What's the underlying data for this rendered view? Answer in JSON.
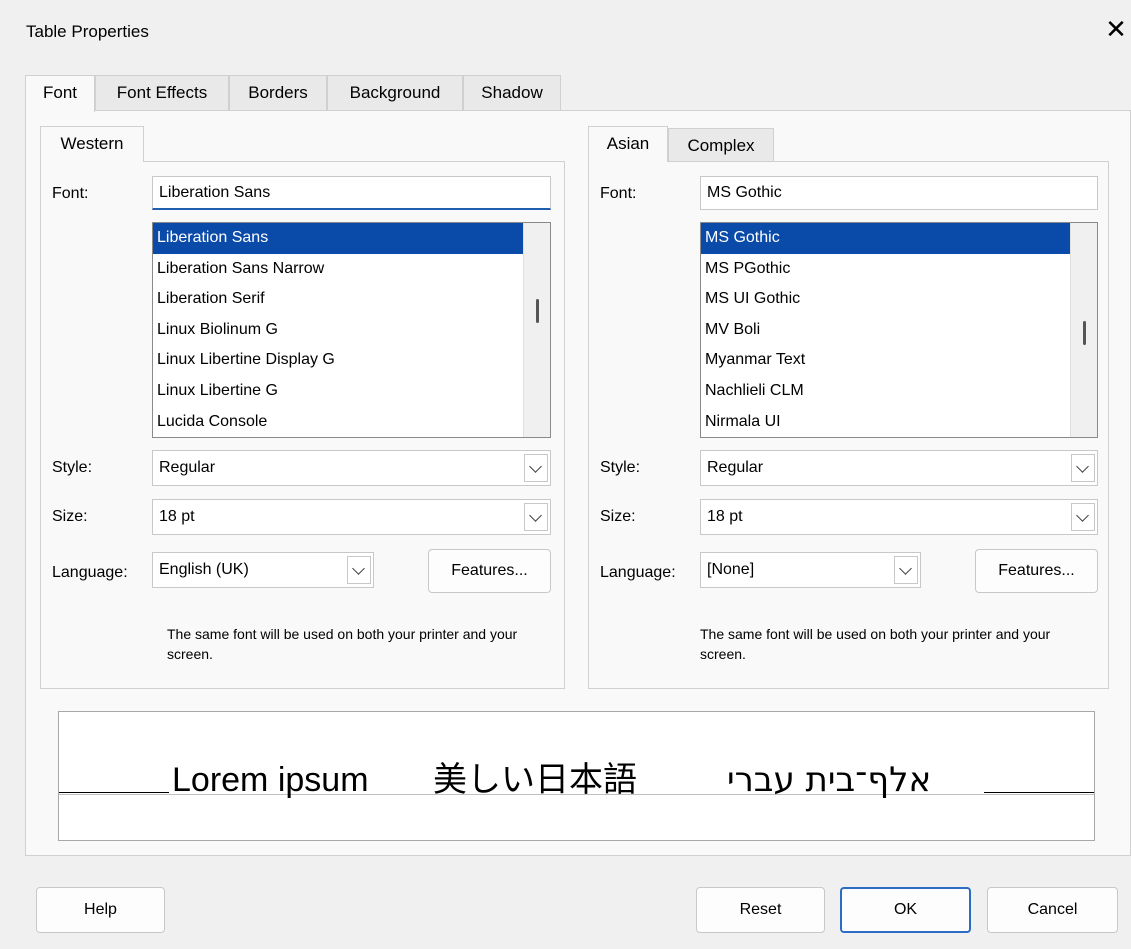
{
  "window": {
    "title": "Table Properties",
    "close_glyph": "✕"
  },
  "tabs": [
    "Font",
    "Font Effects",
    "Borders",
    "Background",
    "Shadow"
  ],
  "western": {
    "tab": "Western",
    "font_label": "Font:",
    "font_value": "Liberation Sans",
    "font_list": [
      "Liberation Sans",
      "Liberation Sans Narrow",
      "Liberation Serif",
      "Linux Biolinum G",
      "Linux Libertine Display G",
      "Linux Libertine G",
      "Lucida Console"
    ],
    "style_label": "Style:",
    "style_value": "Regular",
    "size_label": "Size:",
    "size_value": "18 pt",
    "language_label": "Language:",
    "language_value": "English (UK)",
    "features_label": "Features...",
    "note": "The same font will be used on both your printer and your screen."
  },
  "asian": {
    "tabs": [
      "Asian",
      "Complex"
    ],
    "font_label": "Font:",
    "font_value": "MS Gothic",
    "font_list": [
      "MS Gothic",
      "MS PGothic",
      "MS UI Gothic",
      "MV Boli",
      "Myanmar Text",
      "Nachlieli CLM",
      "Nirmala UI"
    ],
    "style_label": "Style:",
    "style_value": "Regular",
    "size_label": "Size:",
    "size_value": "18 pt",
    "language_label": "Language:",
    "language_value": "[None]",
    "features_label": "Features...",
    "note": "The same font will be used on both your printer and your screen."
  },
  "preview": {
    "latin": "Lorem ipsum",
    "japanese": "美しい日本語",
    "hebrew": "אלף־בית עברי"
  },
  "buttons": {
    "help": "Help",
    "reset": "Reset",
    "ok": "OK",
    "cancel": "Cancel"
  },
  "colors": {
    "selection": "#0a4aa8",
    "default_button_border": "#2b6cc4",
    "dialog_bg": "#f0f0f0"
  }
}
